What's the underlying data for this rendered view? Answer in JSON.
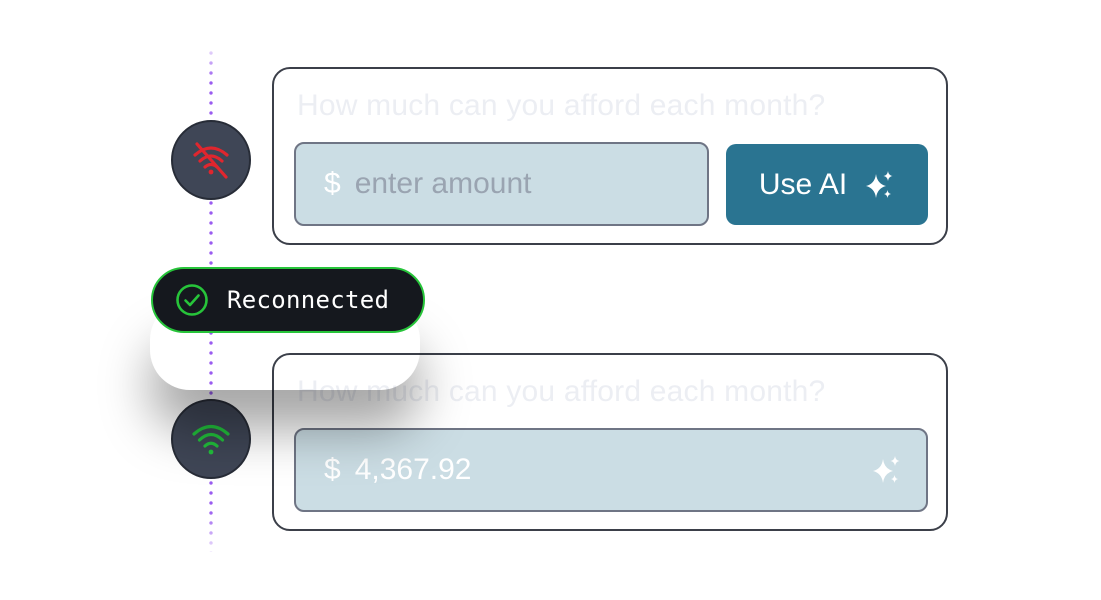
{
  "timeline": {
    "line_color": "#9a5cf0"
  },
  "status_icons": {
    "offline": {
      "icon": "wifi-off-icon",
      "color": "#e0262e"
    },
    "online": {
      "icon": "wifi-icon",
      "color": "#22c13c"
    }
  },
  "toast": {
    "text": "Reconnected",
    "icon": "check-circle-icon",
    "accent_color": "#27c43a"
  },
  "card_offline": {
    "question": "How much can you afford each month?",
    "currency_symbol": "$",
    "amount_placeholder": "enter amount",
    "ai_button_label": "Use AI",
    "ai_button_icon": "sparkles-icon",
    "ai_button_color": "#2a7491"
  },
  "card_online": {
    "question": "How much can you afford each month?",
    "currency_symbol": "$",
    "amount_value": "4,367.92",
    "field_icon": "sparkles-icon"
  }
}
